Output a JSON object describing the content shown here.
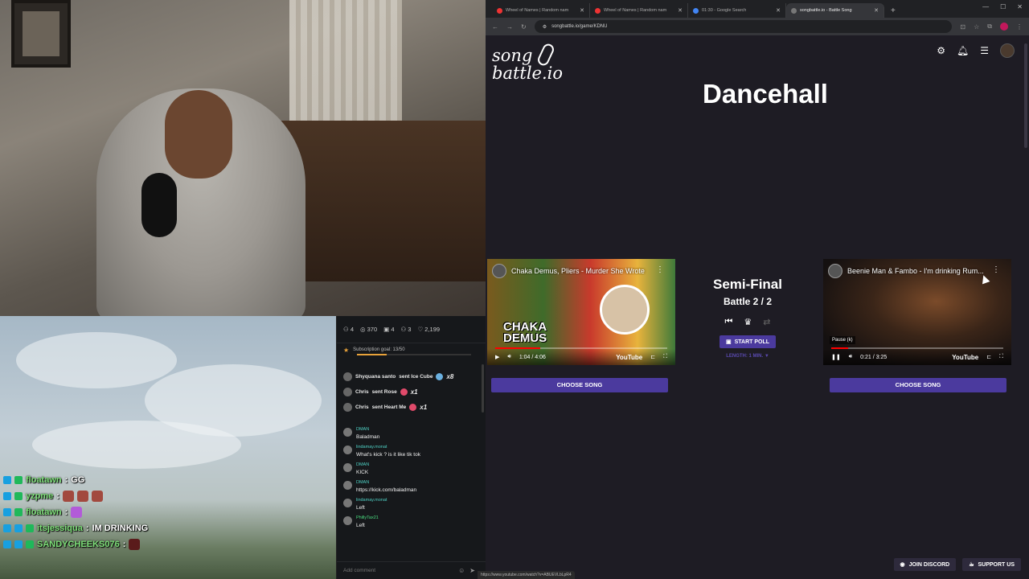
{
  "overlay_chat": [
    {
      "user": "floatawn",
      "text": "GG",
      "emotes": 0,
      "badges": [
        "b",
        "g"
      ]
    },
    {
      "user": "yzpme",
      "text": "",
      "emotes": 3,
      "badges": [
        "b",
        "g"
      ]
    },
    {
      "user": "floatawn",
      "text": "",
      "emotes": 1,
      "badges": [
        "b",
        "g"
      ]
    },
    {
      "user": "itsjessiqua",
      "text": "IM DRINKING",
      "emotes": 0,
      "badges": [
        "b",
        "b",
        "g"
      ]
    },
    {
      "user": "SANDYCHEEKS076",
      "text": "",
      "emotes": 1,
      "badges": [
        "b",
        "b",
        "g"
      ]
    }
  ],
  "kick": {
    "stats": {
      "viewers_a": "4",
      "views": "370",
      "gifts": "4",
      "subs": "3",
      "likes": "2,199"
    },
    "goal_label": "Subscription goal: 13/50",
    "goal_fraction": 0.26,
    "gifts": [
      {
        "user": "Shyquana santo",
        "action": "sent Ice Cube",
        "mult": "x8"
      },
      {
        "user": "Chris",
        "action": "sent Rose",
        "mult": "x1"
      },
      {
        "user": "Chris",
        "action": "sent Heart Me",
        "mult": "x1"
      }
    ],
    "messages": [
      {
        "user": "DMAN",
        "text": "Baladman"
      },
      {
        "user": "lindamay.monat",
        "text": "What's kick ? is it like tik tok"
      },
      {
        "user": "DMAN",
        "text": "KICK"
      },
      {
        "user": "DMAN",
        "text": "https://kick.com/baladman"
      },
      {
        "user": "lindamay.monat",
        "text": "Left"
      },
      {
        "user": "PhillyTax21",
        "text": "Left"
      }
    ],
    "input_placeholder": "Add comment"
  },
  "browser": {
    "tabs": [
      {
        "label": "Wheel of Names | Random nam",
        "active": false
      },
      {
        "label": "Wheel of Names | Random nam",
        "active": false
      },
      {
        "label": "01:30 - Google Search",
        "active": false
      },
      {
        "label": "songbattle.io - Battle Song",
        "active": true
      }
    ],
    "url": "songbattle.io/game/KDNU",
    "status_url": "https://www.youtube.com/watch?v=ABUEVLbLpR4"
  },
  "page": {
    "logo_top": "song",
    "logo_bottom": "battle.io",
    "genre": "Dancehall",
    "round": "Semi-Final",
    "battle": "Battle 2 / 2",
    "start_poll": "START POLL",
    "length": "LENGTH: 1 MIN. ▼",
    "choose_left": "CHOOSE SONG",
    "choose_right": "CHOOSE SONG",
    "join_discord": "JOIN DISCORD",
    "support_us": "SUPPORT US"
  },
  "videos": {
    "left": {
      "title": "Chaka Demus, Pliers - Murder She Wrote",
      "big_text_1": "CHAKA",
      "big_text_2": "DEMUS",
      "time": "1:04 / 4:06",
      "progress": 0.26,
      "brand": "YouTube"
    },
    "right": {
      "title": "Beenie Man & Fambo - I'm drinking Rum...",
      "time": "0:21 / 3:25",
      "progress": 0.1,
      "pause_label": "Pause (k)",
      "brand": "YouTube"
    }
  }
}
